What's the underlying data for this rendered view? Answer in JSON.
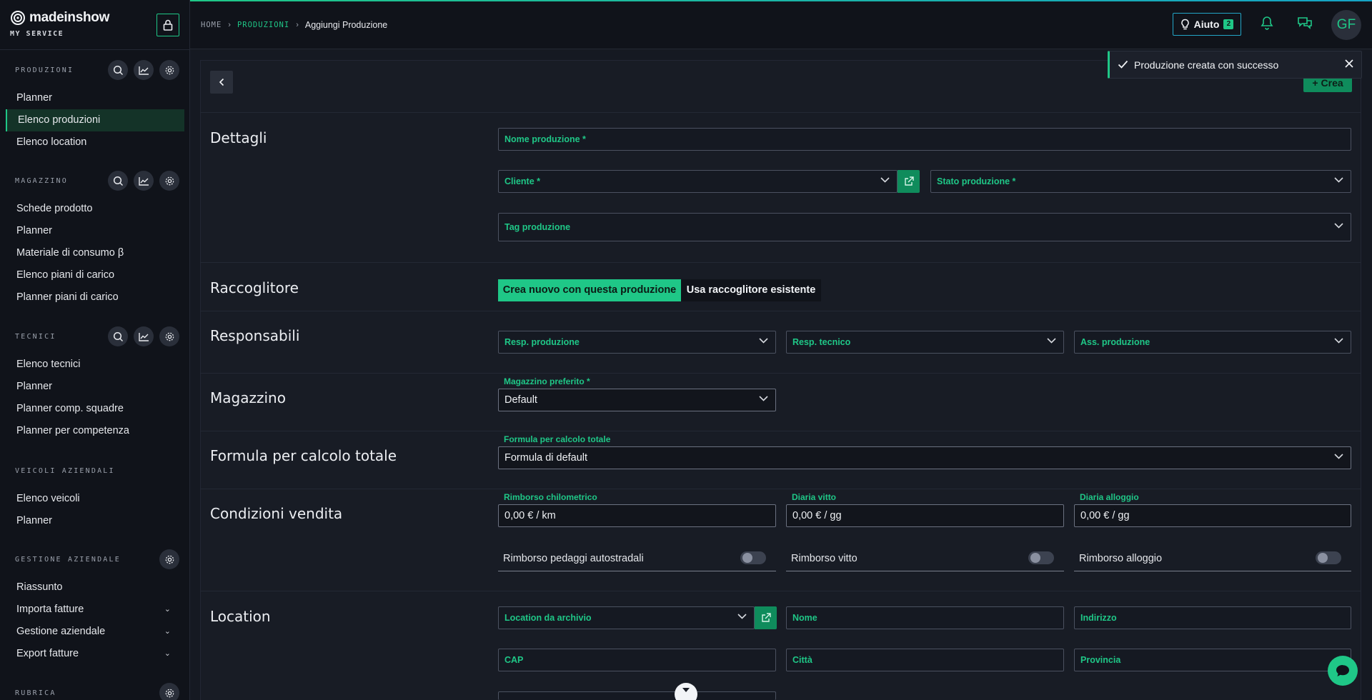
{
  "brand": {
    "name": "madeinshow",
    "subtitle": "MY SERVICE"
  },
  "sidebar": {
    "sections": [
      {
        "title": "PRODUZIONI",
        "items": [
          "Planner",
          "Elenco produzioni",
          "Elenco location"
        ]
      },
      {
        "title": "MAGAZZINO",
        "items": [
          "Schede prodotto",
          "Planner",
          "Materiale di consumo β",
          "Elenco piani di carico",
          "Planner piani di carico"
        ]
      },
      {
        "title": "TECNICI",
        "items": [
          "Elenco tecnici",
          "Planner",
          "Planner comp. squadre",
          "Planner per competenza"
        ]
      },
      {
        "title": "VEICOLI AZIENDALI",
        "items": [
          "Elenco veicoli",
          "Planner"
        ]
      },
      {
        "title": "GESTIONE AZIENDALE",
        "items": [
          "Riassunto",
          "Importa fatture",
          "Gestione aziendale",
          "Export fatture"
        ]
      },
      {
        "title": "RUBRICA",
        "items": []
      }
    ],
    "active_item": "Elenco produzioni"
  },
  "header": {
    "breadcrumb": {
      "home": "HOME",
      "section": "PRODUZIONI",
      "current": "Aggiungi Produzione"
    },
    "help_label": "Aiuto",
    "help_badge": "2",
    "avatar_initials": "GF"
  },
  "toast": {
    "message": "Produzione creata con successo"
  },
  "actions": {
    "create_label": "Crea"
  },
  "form": {
    "dettagli": {
      "title": "Dettagli",
      "nome": "Nome produzione *",
      "cliente": "Cliente *",
      "stato": "Stato produzione *",
      "tag": "Tag produzione"
    },
    "raccoglitore": {
      "title": "Raccoglitore",
      "option_new": "Crea nuovo con questa produzione",
      "option_existing": "Usa raccoglitore esistente"
    },
    "responsabili": {
      "title": "Responsabili",
      "resp_produzione": "Resp. produzione",
      "resp_tecnico": "Resp. tecnico",
      "ass_produzione": "Ass. produzione"
    },
    "magazzino": {
      "title": "Magazzino",
      "label": "Magazzino preferito *",
      "value": "Default"
    },
    "formula": {
      "title": "Formula per calcolo totale",
      "label": "Formula per calcolo totale",
      "value": "Formula di default"
    },
    "condizioni": {
      "title": "Condizioni vendita",
      "km_label": "Rimborso chilometrico",
      "km_value": "0,00 € / km",
      "vitto_label": "Diaria vitto",
      "vitto_value": "0,00 € / gg",
      "alloggio_label": "Diaria alloggio",
      "alloggio_value": "0,00 € / gg",
      "toggle_pedaggi": "Rimborso pedaggi autostradali",
      "toggle_vitto": "Rimborso vitto",
      "toggle_alloggio": "Rimborso alloggio"
    },
    "location": {
      "title": "Location",
      "archivio": "Location da archivio",
      "nome": "Nome",
      "indirizzo": "Indirizzo",
      "cap": "CAP",
      "citta": "Città",
      "provincia": "Provincia"
    }
  },
  "colors": {
    "accent": "#1fc787",
    "accent_dark": "#0f8c5c",
    "help_border": "#23a6c7",
    "bg": "#161a22",
    "sidebar": "#10131a"
  }
}
